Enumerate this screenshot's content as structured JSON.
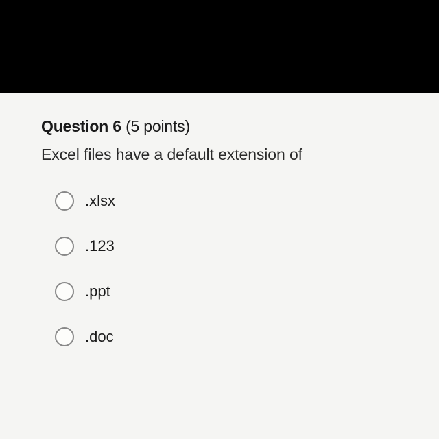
{
  "question": {
    "label": "Question 6",
    "points": "(5 points)",
    "prompt": "Excel files have a default extension of",
    "options": [
      {
        "label": ".xlsx"
      },
      {
        "label": ".123"
      },
      {
        "label": ".ppt"
      },
      {
        "label": ".doc"
      }
    ]
  }
}
